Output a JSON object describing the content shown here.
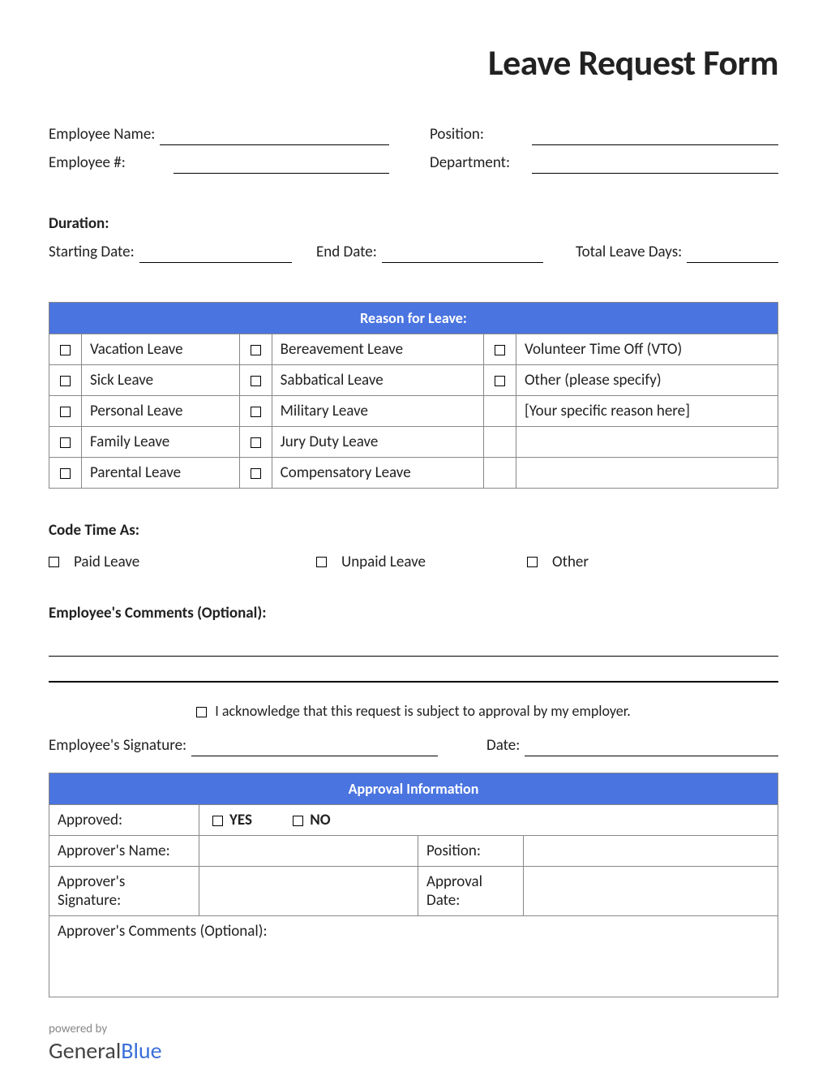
{
  "title": "Leave Request Form",
  "employee": {
    "name_label": "Employee Name:",
    "number_label": "Employee #:",
    "position_label": "Position:",
    "department_label": "Department:"
  },
  "duration": {
    "heading": "Duration:",
    "start_label": "Starting Date:",
    "end_label": "End Date:",
    "total_label": "Total Leave Days:"
  },
  "reason": {
    "header": "Reason for Leave:",
    "col1": [
      "Vacation Leave",
      "Sick Leave",
      "Personal Leave",
      "Family Leave",
      "Parental Leave"
    ],
    "col2": [
      "Bereavement Leave",
      "Sabbatical Leave",
      "Military Leave",
      "Jury Duty Leave",
      "Compensatory Leave"
    ],
    "col3": [
      "Volunteer Time Off (VTO)",
      "Other (please specify)",
      "[Your specific reason here]",
      "",
      ""
    ]
  },
  "code_time": {
    "heading": "Code Time As:",
    "options": [
      "Paid Leave",
      "Unpaid Leave",
      "Other"
    ]
  },
  "comments": {
    "heading": "Employee's Comments (Optional):"
  },
  "acknowledge": "I acknowledge that this request is subject to approval by my employer.",
  "signature": {
    "emp_sig_label": "Employee's Signature:",
    "date_label": "Date:"
  },
  "approval": {
    "header": "Approval Information",
    "approved_label": "Approved:",
    "yes": "YES",
    "no": "NO",
    "approver_name_label": "Approver's Name:",
    "position_label": "Position:",
    "approver_sig_label": "Approver's Signature:",
    "approval_date_label": "Approval Date:",
    "comments_label": "Approver's Comments (Optional):"
  },
  "footer": {
    "powered_by": "powered by",
    "brand1": "General",
    "brand2": "Blue"
  }
}
